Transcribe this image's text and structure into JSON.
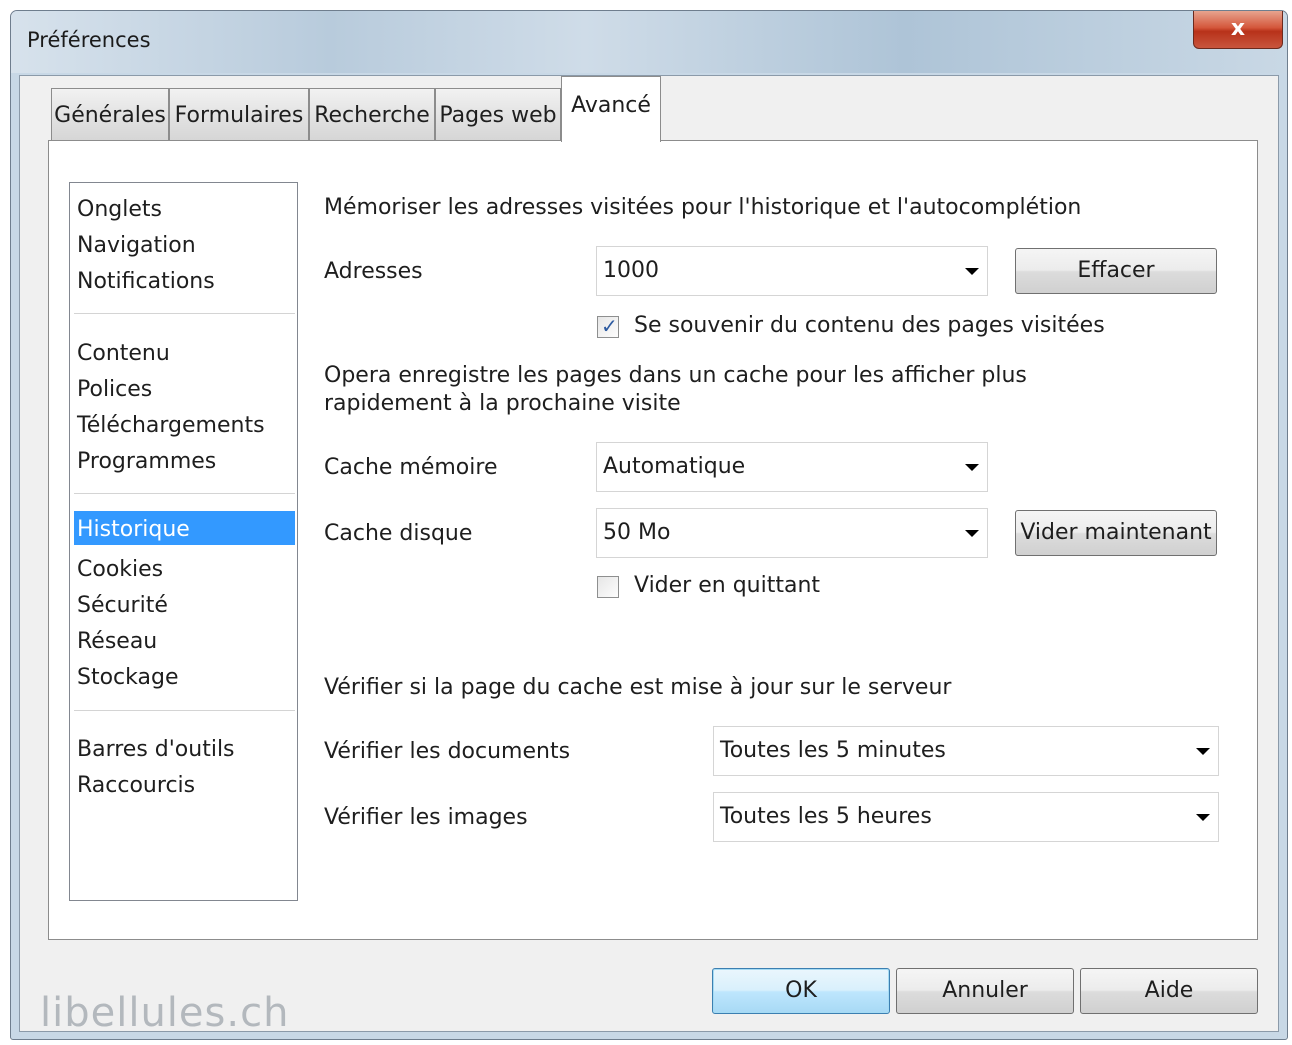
{
  "window": {
    "title": "Préférences",
    "close_glyph": "x"
  },
  "tabs": [
    {
      "label": "Générales"
    },
    {
      "label": "Formulaires"
    },
    {
      "label": "Recherche"
    },
    {
      "label": "Pages web"
    },
    {
      "label": "Avancé"
    }
  ],
  "active_tab": "Avancé",
  "sidebar": {
    "items": [
      {
        "label": "Onglets"
      },
      {
        "label": "Navigation"
      },
      {
        "label": "Notifications"
      },
      {
        "label": "Contenu"
      },
      {
        "label": "Polices"
      },
      {
        "label": "Téléchargements"
      },
      {
        "label": "Programmes"
      },
      {
        "label": "Historique"
      },
      {
        "label": "Cookies"
      },
      {
        "label": "Sécurité"
      },
      {
        "label": "Réseau"
      },
      {
        "label": "Stockage"
      },
      {
        "label": "Barres d'outils"
      },
      {
        "label": "Raccourcis"
      }
    ],
    "selected": "Historique"
  },
  "history": {
    "heading": "Mémoriser les adresses visitées pour l'historique et l'autocomplétion",
    "addresses_label": "Adresses",
    "addresses_value": "1000",
    "clear_button": "Effacer",
    "remember_content_label": "Se souvenir du contenu des pages visitées",
    "remember_content_checked": true
  },
  "cache": {
    "description_line1": "Opera enregistre les pages dans un cache pour les afficher plus",
    "description_line2": "rapidement à la prochaine visite",
    "memory_label": "Cache mémoire",
    "memory_value": "Automatique",
    "disk_label": "Cache disque",
    "disk_value": "50 Mo",
    "empty_now_button": "Vider maintenant",
    "empty_on_exit_label": "Vider en quittant",
    "empty_on_exit_checked": false
  },
  "check": {
    "heading": "Vérifier si la page du cache est mise à jour sur le serveur",
    "documents_label": "Vérifier les documents",
    "documents_value": "Toutes les 5 minutes",
    "images_label": "Vérifier les images",
    "images_value": "Toutes les 5 heures"
  },
  "footer": {
    "ok": "OK",
    "cancel": "Annuler",
    "help": "Aide",
    "watermark": "libellules.ch"
  },
  "icons": {
    "dropdown": "chevron-down-icon",
    "checkmark": "check-icon"
  }
}
